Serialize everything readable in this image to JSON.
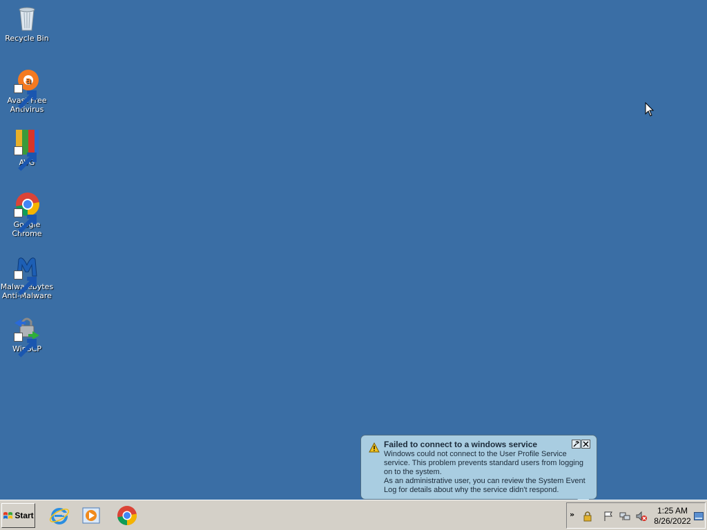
{
  "desktop": {
    "icons": [
      {
        "label": "Recycle Bin",
        "icon": "recycle-bin-icon"
      },
      {
        "label": "Avast Free Antivirus",
        "icon": "avast-icon"
      },
      {
        "label": "AVG",
        "icon": "avg-icon"
      },
      {
        "label": "Google Chrome",
        "icon": "chrome-icon"
      },
      {
        "label": "Malwarebytes Anti-Malware",
        "icon": "malwarebytes-icon"
      },
      {
        "label": "WinSCP",
        "icon": "winscp-icon"
      }
    ]
  },
  "notification": {
    "title": "Failed to connect to a windows service",
    "line1": "Windows could not connect to the User Profile Service service. This problem prevents standard users from logging on to the system.",
    "line2": "As an administrative user, you can review the System Event Log for details about why the service didn't respond."
  },
  "taskbar": {
    "start_label": "Start",
    "quick_launch": [
      "internet-explorer-icon",
      "media-player-icon",
      "chrome-icon"
    ],
    "tray": {
      "chevron": "»",
      "icons": [
        "lock-icon",
        "flag-icon",
        "network-icon",
        "sound-muted-icon"
      ]
    },
    "clock": {
      "time": "1:25 AM",
      "date": "8/26/2022"
    }
  },
  "colors": {
    "desktop_bg": "#3a6ea5",
    "taskbar_bg": "#d4d0c8",
    "balloon_bg": "#a9cde1"
  }
}
